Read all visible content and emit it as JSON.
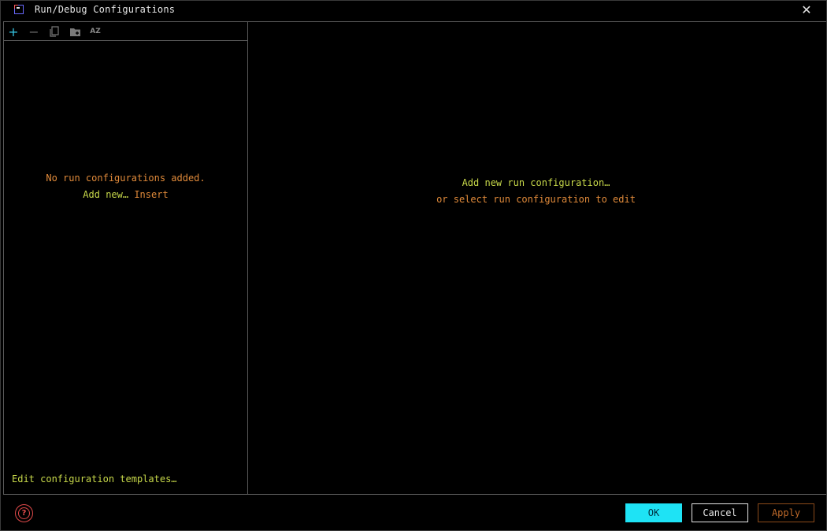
{
  "window": {
    "title": "Run/Debug Configurations",
    "close_glyph": "✕"
  },
  "toolbar": {
    "add_glyph": "+",
    "remove_glyph": "−",
    "sort_glyph": "AZ"
  },
  "left_pane": {
    "empty_message": "No run configurations added.",
    "add_new_label": "Add new…",
    "add_new_shortcut": "Insert",
    "edit_templates_label": "Edit configuration templates…"
  },
  "right_pane": {
    "add_new_label": "Add new run configuration…",
    "select_hint": "or select run configuration to edit"
  },
  "footer": {
    "help_glyph": "?",
    "ok_label": "OK",
    "cancel_label": "Cancel",
    "apply_label": "Apply"
  },
  "colors": {
    "background": "#000000",
    "accent_cyan": "#1ee3f5",
    "link_yellow": "#c8d94a",
    "text_orange": "#e08a3a",
    "help_red": "#e04a4a"
  }
}
